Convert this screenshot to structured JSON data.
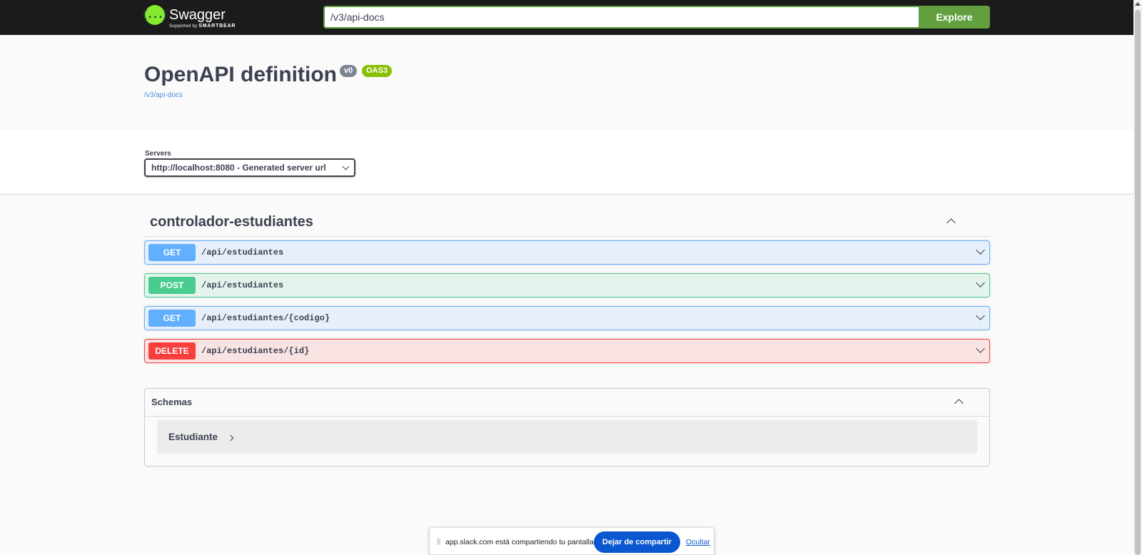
{
  "topbar": {
    "logo_mark": "{...}",
    "logo_text": "Swagger",
    "logo_supported": "Supported by",
    "logo_brand": "SMARTBEAR",
    "url_value": "/v3/api-docs",
    "explore_label": "Explore"
  },
  "info": {
    "title": "OpenAPI definition",
    "version_badge": "v0",
    "oas_badge": "OAS3",
    "spec_link": "/v3/api-docs"
  },
  "servers": {
    "label": "Servers",
    "selected": "http://localhost:8080 - Generated server url"
  },
  "tag": {
    "name": "controlador-estudiantes",
    "operations": [
      {
        "method": "GET",
        "path": "/api/estudiantes"
      },
      {
        "method": "POST",
        "path": "/api/estudiantes"
      },
      {
        "method": "GET",
        "path": "/api/estudiantes/{codigo}"
      },
      {
        "method": "DELETE",
        "path": "/api/estudiantes/{id}"
      }
    ]
  },
  "schemas": {
    "title": "Schemas",
    "items": [
      "Estudiante"
    ]
  },
  "share_bar": {
    "message": "app.slack.com está compartiendo tu pantalla.",
    "stop_label": "Dejar de compartir",
    "hide_label": "Ocultar"
  },
  "colors": {
    "topbar": "#1b1b1b",
    "accent_green": "#62a03f",
    "get": "#61affe",
    "post": "#49cc90",
    "delete": "#f93e3e",
    "share_button": "#0b57d0"
  }
}
